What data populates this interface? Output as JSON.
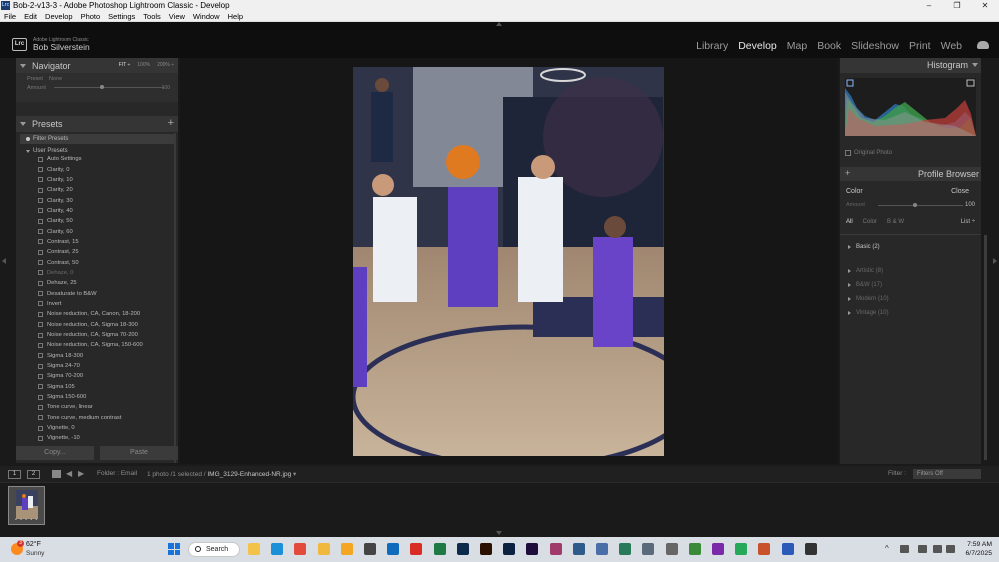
{
  "window": {
    "title": "Bob-2-v13-3 - Adobe Photoshop Lightroom Classic - Develop",
    "minimize_icon": "–",
    "maximize_icon": "❐",
    "close_icon": "✕"
  },
  "menu": [
    "File",
    "Edit",
    "Develop",
    "Photo",
    "Settings",
    "Tools",
    "View",
    "Window",
    "Help"
  ],
  "identity": {
    "badge": "Lrc",
    "product": "Adobe Lightroom Classic",
    "user": "Bob Silverstein"
  },
  "modules": {
    "items": [
      "Library",
      "Develop",
      "Map",
      "Book",
      "Slideshow",
      "Print",
      "Web"
    ],
    "active": "Develop"
  },
  "navigator": {
    "title": "Navigator",
    "zoom_options": [
      "FIT ÷",
      "100%",
      "200% ÷"
    ],
    "zoom_selected": "FIT ÷",
    "preset_label": "Preset",
    "preset_value": "None",
    "amount_label": "Amount",
    "amount_value": "100"
  },
  "presets": {
    "title": "Presets",
    "add": "+",
    "filter_placeholder": "Filter Presets",
    "group": "User Presets",
    "items": [
      {
        "label": "Auto Settings",
        "dim": false
      },
      {
        "label": "Clarity, 0",
        "dim": false
      },
      {
        "label": "Clarity, 10",
        "dim": false
      },
      {
        "label": "Clarity, 20",
        "dim": false
      },
      {
        "label": "Clarity, 30",
        "dim": false
      },
      {
        "label": "Clarity, 40",
        "dim": false
      },
      {
        "label": "Clarity, 50",
        "dim": false
      },
      {
        "label": "Clarity, 60",
        "dim": false
      },
      {
        "label": "Contrast, 15",
        "dim": false
      },
      {
        "label": "Contrast, 25",
        "dim": false
      },
      {
        "label": "Contrast, 50",
        "dim": false
      },
      {
        "label": "Dehaze, 0",
        "dim": true
      },
      {
        "label": "Dehaze, 25",
        "dim": false
      },
      {
        "label": "Desaturate to B&W",
        "dim": false
      },
      {
        "label": "Invert",
        "dim": false
      },
      {
        "label": "Noise reduction, CA, Canon, 18-200",
        "dim": false
      },
      {
        "label": "Noise reduction, CA, Sigma 18-300",
        "dim": false
      },
      {
        "label": "Noise reduction, CA, Sigma 70-200",
        "dim": false
      },
      {
        "label": "Noise reduction, CA, Sigma, 150-600",
        "dim": false
      },
      {
        "label": "Sigma 18-300",
        "dim": false
      },
      {
        "label": "Sigma 24-70",
        "dim": false
      },
      {
        "label": "Sigma 70-200",
        "dim": false
      },
      {
        "label": "Sigma 105",
        "dim": false
      },
      {
        "label": "Sigma 150-600",
        "dim": false
      },
      {
        "label": "Tone curve, linear",
        "dim": false
      },
      {
        "label": "Tone curve, medium contrast",
        "dim": false
      },
      {
        "label": "Vignette, 0",
        "dim": false
      },
      {
        "label": "Vignette, -10",
        "dim": false
      }
    ],
    "copy_button": "Copy...",
    "paste_button": "Paste"
  },
  "histogram": {
    "title": "Histogram",
    "original_photo": "Original Photo"
  },
  "profile_browser": {
    "title": "Profile Browser",
    "add": "+",
    "current": "Color",
    "close": "Close",
    "amount_label": "Amount",
    "amount_value": "100",
    "tabs": [
      "All",
      "Color",
      "B & W"
    ],
    "tab_selected": "All",
    "view": "List ÷",
    "categories": [
      {
        "label": "Basic (2)",
        "dim": false
      },
      {
        "label": "Artistic (8)",
        "dim": true
      },
      {
        "label": "B&W (17)",
        "dim": true
      },
      {
        "label": "Modern (10)",
        "dim": true
      },
      {
        "label": "Vintage (10)",
        "dim": true
      }
    ]
  },
  "filmstrip_bar": {
    "view1": "1",
    "view2": "2",
    "folder": "Folder : Email",
    "count": "1 photo /1 selected /",
    "filename": "IMG_3129-Enhanced-NR.jpg",
    "filename_caret": "▾",
    "filter_label": "Filter :",
    "filter_value": "Filters Off"
  },
  "thumbnail": {
    "rating_dots": "• • • • •"
  },
  "taskbar": {
    "weather_badge": "3",
    "temperature": "62°F",
    "condition": "Sunny",
    "search_label": "Search",
    "time": "7:59 AM",
    "date": "6/7/2025",
    "apps": [
      {
        "name": "file-explorer-icon",
        "color": "#f3c24a"
      },
      {
        "name": "edge-icon",
        "color": "#1b8fd8"
      },
      {
        "name": "chrome-icon",
        "color": "#e24a3b"
      },
      {
        "name": "folder-icon",
        "color": "#f0b83c"
      },
      {
        "name": "weather-app-icon",
        "color": "#f4a623"
      },
      {
        "name": "media-player-icon",
        "color": "#444444"
      },
      {
        "name": "outlook-icon",
        "color": "#0f6cbd"
      },
      {
        "name": "acrobat-icon",
        "color": "#d92c25"
      },
      {
        "name": "excel-icon",
        "color": "#1d7a45"
      },
      {
        "name": "lightroom-icon",
        "color": "#0c2a4c"
      },
      {
        "name": "illustrator-icon",
        "color": "#2b1000"
      },
      {
        "name": "photoshop-icon",
        "color": "#0b2240"
      },
      {
        "name": "premiere-icon",
        "color": "#1f0e3c"
      },
      {
        "name": "photos-app-icon",
        "color": "#a03a6a"
      },
      {
        "name": "media-app-icon",
        "color": "#2d5c8a"
      },
      {
        "name": "feather-app-icon",
        "color": "#4a6ea8"
      },
      {
        "name": "dvd-app-icon",
        "color": "#2a7a5a"
      },
      {
        "name": "monitor-app-icon",
        "color": "#5a6a7a"
      },
      {
        "name": "printer-icon",
        "color": "#666666"
      },
      {
        "name": "backup-app-icon",
        "color": "#3a8a3a"
      },
      {
        "name": "onenote-icon",
        "color": "#7a2aa8"
      },
      {
        "name": "whatsapp-icon",
        "color": "#25a85a"
      },
      {
        "name": "powerpoint-icon",
        "color": "#c8502a"
      },
      {
        "name": "word-icon",
        "color": "#2b5ab8"
      },
      {
        "name": "terminal-icon",
        "color": "#333333"
      }
    ]
  }
}
